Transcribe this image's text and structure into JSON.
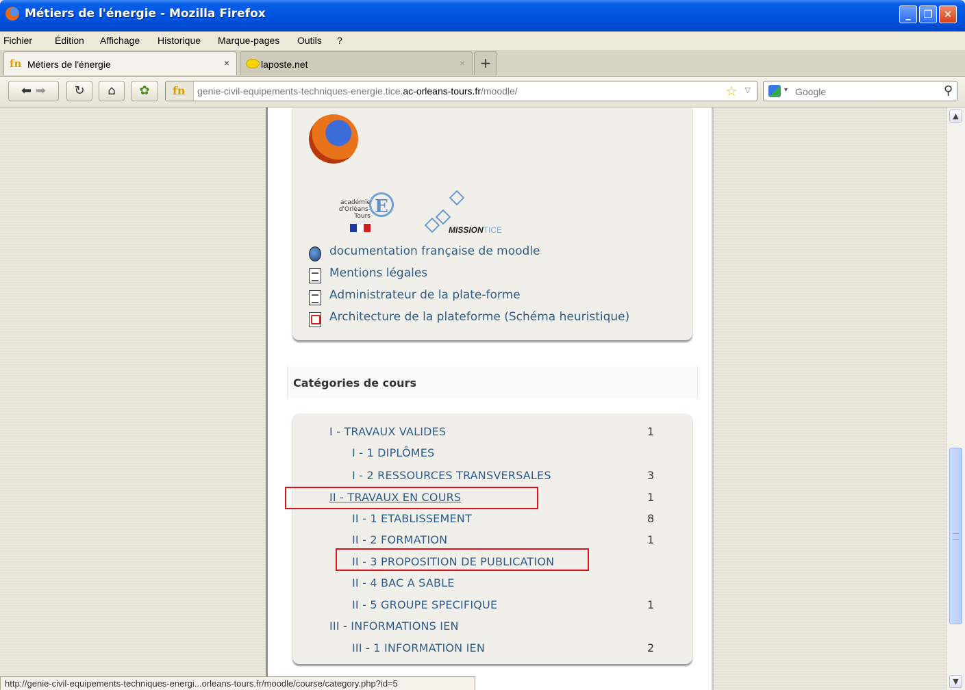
{
  "window": {
    "title": "Métiers de l'énergie - Mozilla Firefox"
  },
  "menu": [
    "Fichier",
    "Édition",
    "Affichage",
    "Historique",
    "Marque-pages",
    "Outils",
    "?"
  ],
  "tabs": [
    {
      "label": "Métiers de l'énergie",
      "close": "×"
    },
    {
      "label": "laposte.net",
      "close": "×"
    }
  ],
  "newtab": "+",
  "url": {
    "prefix": "genie-civil-equipements-techniques-energie.tice.",
    "domain": "ac-orleans-tours.fr",
    "path": "/moodle/"
  },
  "search": {
    "placeholder": "Google"
  },
  "logos": {
    "academie": "académie d'Orléans-Tours",
    "mission": "MISSION",
    "mission_suffix": "TICE"
  },
  "links": [
    {
      "icon": "globe-icon",
      "label": "documentation française de moodle"
    },
    {
      "icon": "document-icon",
      "label": "Mentions légales"
    },
    {
      "icon": "document-icon",
      "label": "Administrateur de la plate-forme"
    },
    {
      "icon": "pdf-icon",
      "label": "Architecture de la plateforme (Schéma heuristique)"
    }
  ],
  "categories_block": {
    "heading": "Catégories de cours",
    "items": [
      {
        "label": "I - TRAVAUX VALIDES",
        "count": "1"
      },
      {
        "label": "I - 1 DIPLÔMES",
        "count": ""
      },
      {
        "label": "I - 2 RESSOURCES TRANSVERSALES",
        "count": "3"
      },
      {
        "label": "II - TRAVAUX EN COURS",
        "count": "1"
      },
      {
        "label": "II - 1 ETABLISSEMENT",
        "count": "8"
      },
      {
        "label": "II - 2 FORMATION",
        "count": "1"
      },
      {
        "label": "II - 3 PROPOSITION DE PUBLICATION",
        "count": ""
      },
      {
        "label": "II - 4 BAC A SABLE",
        "count": ""
      },
      {
        "label": "II - 5 GROUPE SPECIFIQUE",
        "count": "1"
      },
      {
        "label": "III - INFORMATIONS IEN",
        "count": ""
      },
      {
        "label": "III - 1 INFORMATION IEN",
        "count": "2"
      }
    ]
  },
  "status": "http://genie-civil-equipements-techniques-energi...orleans-tours.fr/moodle/course/category.php?id=5",
  "colors": {
    "titlebar": "#0053e0",
    "link": "#2e5c8a",
    "highlight": "#e0101a"
  }
}
